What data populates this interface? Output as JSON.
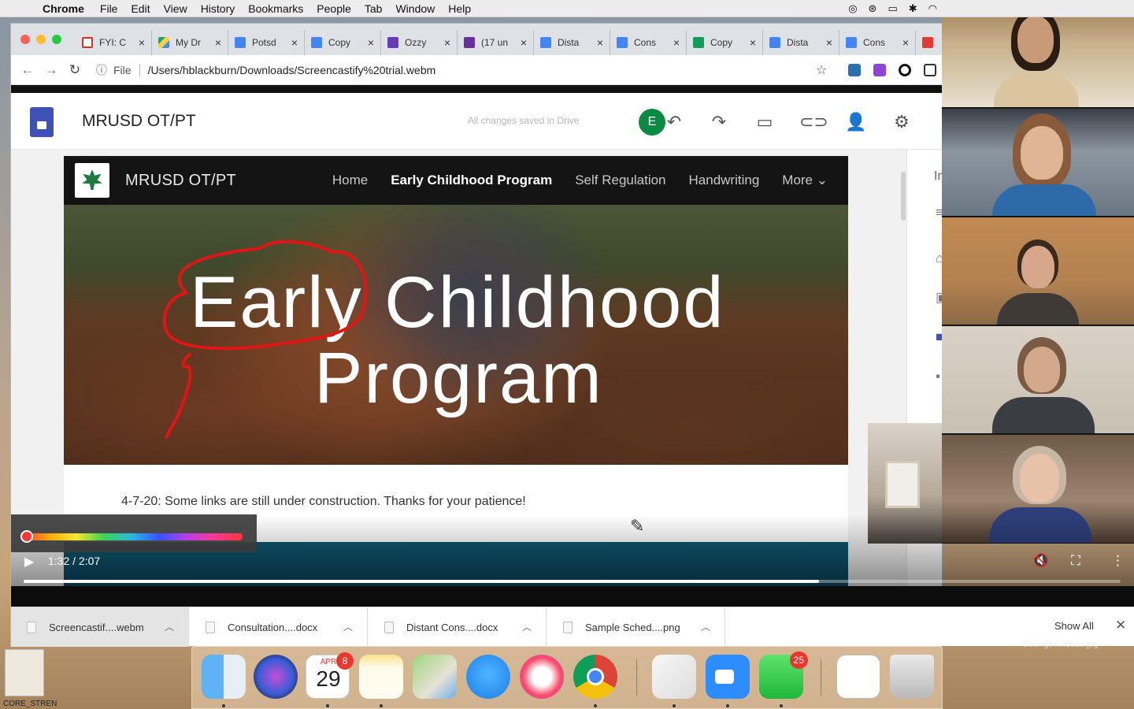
{
  "menubar": {
    "app": "Chrome",
    "items": [
      "File",
      "Edit",
      "View",
      "History",
      "Bookmarks",
      "People",
      "Tab",
      "Window",
      "Help"
    ]
  },
  "tabs": [
    {
      "label": "FYI: C",
      "icon": "gmail-icon"
    },
    {
      "label": "My Dr",
      "icon": "drive-icon"
    },
    {
      "label": "Potsd",
      "icon": "docs-icon"
    },
    {
      "label": "Copy",
      "icon": "docs-icon"
    },
    {
      "label": "Ozzy",
      "icon": "forms-icon"
    },
    {
      "label": "(17 un",
      "icon": "mail-icon"
    },
    {
      "label": "Dista",
      "icon": "docs-icon"
    },
    {
      "label": "Cons",
      "icon": "docs-icon"
    },
    {
      "label": "Copy",
      "icon": "sheets-icon"
    },
    {
      "label": "Dista",
      "icon": "docs-icon"
    },
    {
      "label": "Cons",
      "icon": "docs-icon"
    }
  ],
  "omnibox": {
    "scheme_label": "File",
    "url": "/Users/hblackburn/Downloads/Screencastify%20trial.webm"
  },
  "sites_header": {
    "title": "MRUSD OT/PT",
    "save_status": "All changes saved in Drive",
    "avatar_letter": "E"
  },
  "site": {
    "name": "MRUSD OT/PT",
    "nav": [
      "Home",
      "Early Childhood Program",
      "Self Regulation",
      "Handwriting",
      "More"
    ],
    "hero_line1": "Early Childhood",
    "hero_line2": "Program",
    "notice": "4-7-20: Some links are still under construction.  Thanks for your patience!"
  },
  "right_panel": {
    "partial_label": "Ins"
  },
  "video": {
    "time": "1:32 / 2:07",
    "progress": 0.725
  },
  "downloads": {
    "items": [
      "Screencastif....webm",
      "Consultation....docx",
      "Distant Cons....docx",
      "Sample Sched....png"
    ],
    "show_all": "Show All"
  },
  "dock": {
    "calendar_month": "APR",
    "calendar_day": "29",
    "calendar_badge": "8",
    "facetime_badge": "25"
  },
  "desktop": {
    "file_label": "CORE_STREN",
    "right_label": "Strength...Ideas.jpg"
  },
  "colors": {
    "accent_green": "#0b8a43",
    "sites_blue": "#3f51b5",
    "annotation_red": "#e01515"
  }
}
